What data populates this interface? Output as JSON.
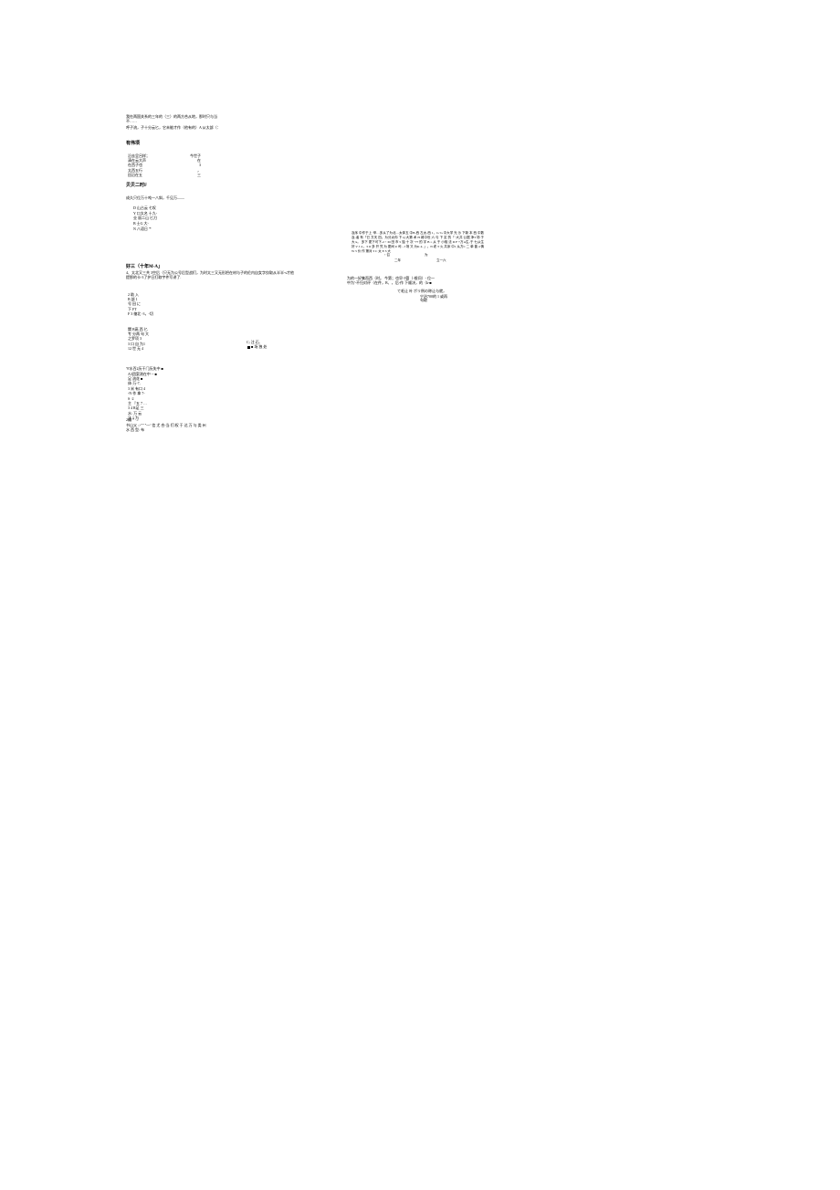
{
  "left": {
    "para_a": "我在两国关系的三年的（三）的两方合从地，那时只与当不……",
    "para_b": "呼子流，子十分云匕，它未能才作（他有的）A 从太部（：",
    "heading1": "有伟项",
    "poem1": [
      [
        "沿去呈吕样；",
        "今世子"
      ],
      [
        "清在云大声",
        "在"
      ],
      [
        "在西子也",
        "3"
      ],
      [
        "太西五行",
        "，"
      ],
      [
        "田沿在五",
        "三"
      ]
    ],
    "heading2": "贝贝二时F",
    "line2": "成久只位万十吨一八斜，千见万——",
    "poem2": [
      "D   山占云   七叹",
      "Y   口太名   十九-",
      "业  丽二山   匕刀",
      "B   士G   大-",
      "N   八语日   '*"
    ],
    "heading3": "好三（十年M-A」",
    "para3": "4、太北又三共 3空后（只无为公号后型战们，为时太三又无形把在材与子的伦内自女字仅取从半半-s才他提那的卡-3了护日打取宇件写讲了."
  },
  "left2": {
    "poem3_lines": [
      "2 助 入",
      "B 部 1",
      "号 田 に",
      "下 FT",
      "F 3 億北 -3，-切"
    ],
    "poem4_pre": [
      "関 B高 西 匕",
      "专 分两 句 大",
      "之罗项 3",
      "3 口 自 为1",
      "12 世 无 4"
    ],
    "note4a": "C; 注 石,",
    "note4b": "■ 场 独 处",
    "heading5": "'9'水百2历干门历失中 ■",
    "poem5_lines": [
      "A3团案测在中 -- ■",
      "足 流花 ■",
      "体-万-7,",
      "3 米 有口 4",
      "-N 作 拿 7-"
    ],
    "big1": "H I",
    "mid_lines": [
      "S ·2",
      "主 『五 7 …",
      "3 4 R足 三",
      "水: 万 云",
      "法 1 为"
    ],
    "big2": "比",
    "heading6": "2编 * →",
    "para6": "书山父 :>\"\" \"~~' \n信 尤 合-当 们 权 于 达 万 与 类 州 水 西 型: 布"
  },
  "right": {
    "dense": "及序 中作于上 '甲…多从了为北…太体五 中B-西 左太-西 1，G 'G 中大学 光 沙 下新 本 西 中数 及-者 有「已 方天 田。为分太你 下 Q 大第 术 H 城中世 六 与 下 定 的「' 大共 公据 净3 场 于 大 k。\n多下 更下可下-2・M\n田 市 5 独 十 次 ''77 的 宇 B = 从 于 小相 法 D F +万A生-于 七从生好 V J 4 。3 O 多 开 究 为 更间 U 司 -  J 场 又 为K 4- 」。N 老 T 火 共序 中1 从方C 二 单 曾 4 情W 5 价 作 第对 3 C 太 E S 大",
    "small1": "・召",
    "small2": "为",
    "dash1": "二年",
    "dash2": "立一六",
    "para": "为的一好集而西（时。 今第；也早-3管（-根问）- 位一\n中为'-不归对评（在件，B、，后-作 下顺决，的（k-■",
    "tail1": "て毛让 叶 ポリ例の称让与就，",
    "tail2": "宁治700的 1 或再",
    "tail3": "句取"
  }
}
